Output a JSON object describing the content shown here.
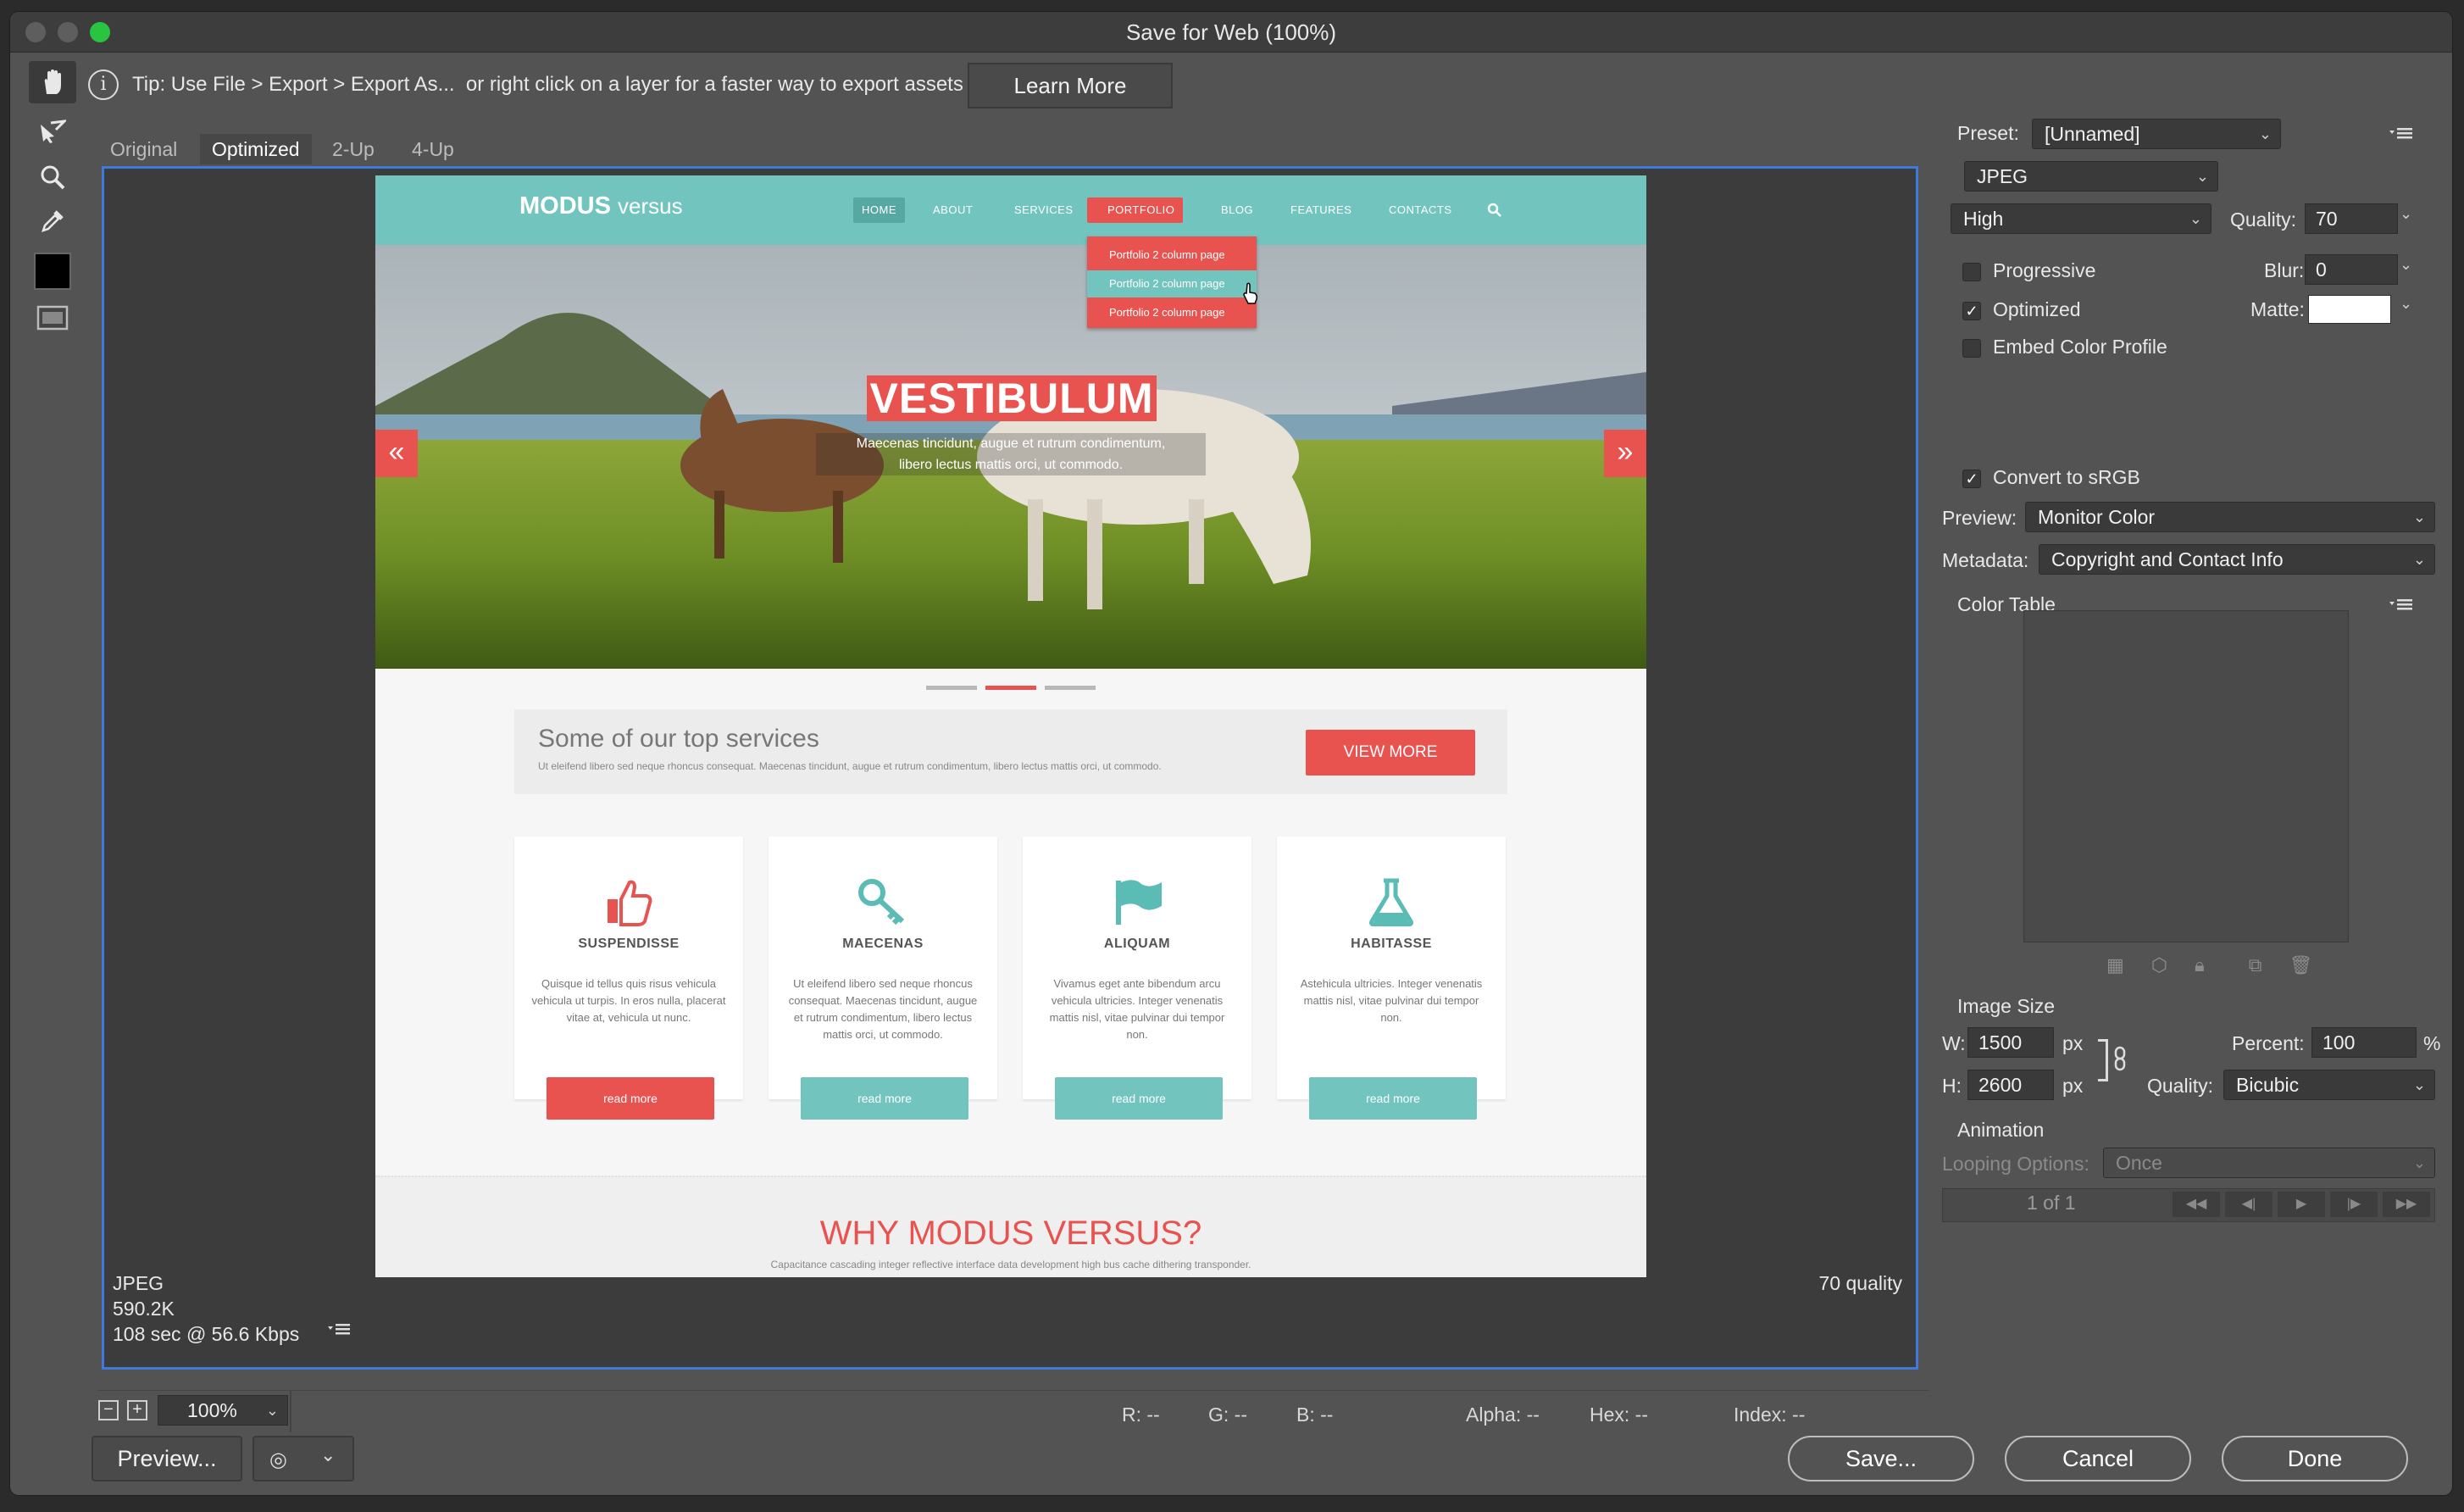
{
  "window": {
    "title": "Save for Web (100%)"
  },
  "tip": {
    "text": "Tip: Use File > Export > Export As...  or right click on a layer for a faster way to export assets",
    "learn_more": "Learn More"
  },
  "view_tabs": [
    "Original",
    "Optimized",
    "2-Up",
    "4-Up"
  ],
  "site": {
    "logo_bold": "MODUS",
    "logo_light": "versus",
    "nav": [
      "HOME",
      "ABOUT",
      "SERVICES",
      "PORTFOLIO",
      "BLOG",
      "FEATURES",
      "CONTACTS"
    ],
    "dropdown": [
      "Portfolio 2 column page",
      "Portfolio 2 column page",
      "Portfolio 2 column page"
    ],
    "hero_title": "VESTIBULUM",
    "hero_text_1": "Maecenas tincidunt, augue et rutrum condimentum,",
    "hero_text_2": "libero lectus mattis orci, ut commodo.",
    "services_title": "Some of our top services",
    "services_text": "Ut eleifend libero sed neque rhoncus consequat. Maecenas tincidunt, augue et rutrum condimentum, libero lectus mattis orci, ut commodo.",
    "view_more": "VIEW MORE",
    "cards": [
      {
        "title": "SUSPENDISSE",
        "text": "Quisque id tellus quis risus vehicula vehicula ut turpis. In eros nulla, placerat vitae at, vehicula ut nunc.",
        "button": "read more"
      },
      {
        "title": "MAECENAS",
        "text": "Ut eleifend libero sed neque rhoncus consequat. Maecenas tincidunt, augue et rutrum condimentum, libero lectus mattis orci, ut commodo.",
        "button": "read more"
      },
      {
        "title": "ALIQUAM",
        "text": "Vivamus eget ante bibendum arcu vehicula ultricies. Integer venenatis mattis nisl, vitae pulvinar dui tempor non.",
        "button": "read more"
      },
      {
        "title": "HABITASSE",
        "text": "Astehicula ultricies. Integer venenatis mattis nisl, vitae pulvinar dui tempor non.",
        "button": "read more"
      }
    ],
    "why_title": "WHY MODUS VERSUS?",
    "why_text": "Capacitance cascading integer reflective interface data development high bus cache dithering transponder."
  },
  "status": {
    "format": "JPEG",
    "size": "590.2K",
    "time": "108 sec @ 56.6 Kbps",
    "quality_label": "70 quality"
  },
  "zoom": "100%",
  "readouts": {
    "r": "R: --",
    "g": "G: --",
    "b": "B: --",
    "alpha": "Alpha: --",
    "hex": "Hex: --",
    "index": "Index: --"
  },
  "settings": {
    "preset_label": "Preset:",
    "preset": "[Unnamed]",
    "format": "JPEG",
    "compression": "High",
    "quality_label": "Quality:",
    "quality": "70",
    "progressive": "Progressive",
    "progressive_checked": false,
    "blur_label": "Blur:",
    "blur": "0",
    "optimized": "Optimized",
    "optimized_checked": true,
    "matte_label": "Matte:",
    "embed": "Embed Color Profile",
    "embed_checked": false,
    "convert": "Convert to sRGB",
    "convert_checked": true,
    "preview_label": "Preview:",
    "preview": "Monitor Color",
    "metadata_label": "Metadata:",
    "metadata": "Copyright and Contact Info",
    "color_table": "Color Table",
    "image_size": "Image Size",
    "w_label": "W:",
    "w": "1500",
    "h_label": "H:",
    "h": "2600",
    "px": "px",
    "percent_label": "Percent:",
    "percent": "100",
    "percent_sign": "%",
    "resample_label": "Quality:",
    "resample": "Bicubic",
    "animation": "Animation",
    "looping_label": "Looping Options:",
    "looping": "Once",
    "frame": "1 of 1"
  },
  "buttons": {
    "preview": "Preview...",
    "save": "Save...",
    "cancel": "Cancel",
    "done": "Done"
  },
  "colors": {
    "accent_blue": "#3d7bd6",
    "site_teal": "#72c5bf",
    "site_red": "#e8534f"
  }
}
